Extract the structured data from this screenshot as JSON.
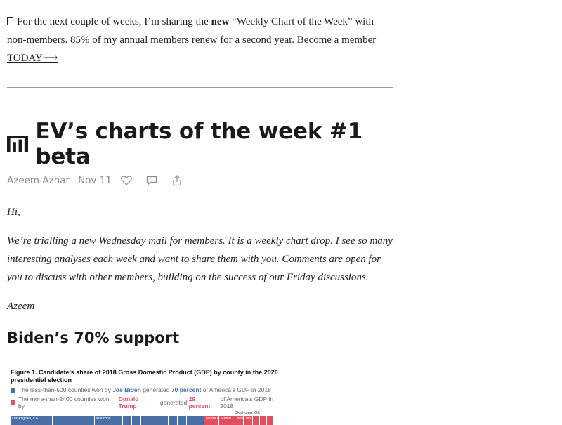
{
  "promo": {
    "glyph": "",
    "text_before": "For the next couple of weeks, I’m sharing the ",
    "bold": "new",
    "text_after": " “Weekly Chart of the Week” with non-members. 85% of my annual members renew for a second year. ",
    "link": "Become a member TODAY⟶"
  },
  "post": {
    "title": "EV’s charts of the week #1 beta",
    "author": "Azeem Azhar",
    "date": "Nov 11",
    "icons": [
      "heart-icon",
      "comment-icon",
      "share-icon"
    ],
    "greeting": "Hi,",
    "paragraph": "We’re trialling a new Wednesday mail for members. It is a weekly chart drop. I see so many interesting analyses each week and want to share them with you. Comments are open for you to discuss with other members, building on the success of our Friday discussions.",
    "signoff": "Azeem",
    "section_heading": "Biden’s 70% support"
  },
  "figure": {
    "title": "Figure 1. Candidate’s share of 2018 Gross Domestic Product (GDP) by county in the 2020 presidential election",
    "legend": [
      {
        "pre": "The less-than-500 counties won by ",
        "name": "Joe Biden",
        "mid": " generated ",
        "pct": "70 percent",
        "post": " of America’s GDP in 2018"
      },
      {
        "pre": "The more-than-2400 counties won by ",
        "name": "Donald Trump",
        "mid": " generated ",
        "pct": "29 percent",
        "post": " of America’s GDP in 2018"
      }
    ],
    "labels": {
      "la": "Los Angeles, CA",
      "maricopa": "Maricopa",
      "nassau": "Nassau",
      "suffolk": "Suffolk",
      "collin": "Collin",
      "tarrant": "Tarr",
      "oklahoma": "Oklahoma, OK"
    },
    "colors": {
      "biden": "#4a6fa5",
      "trump": "#e04f5f"
    }
  }
}
